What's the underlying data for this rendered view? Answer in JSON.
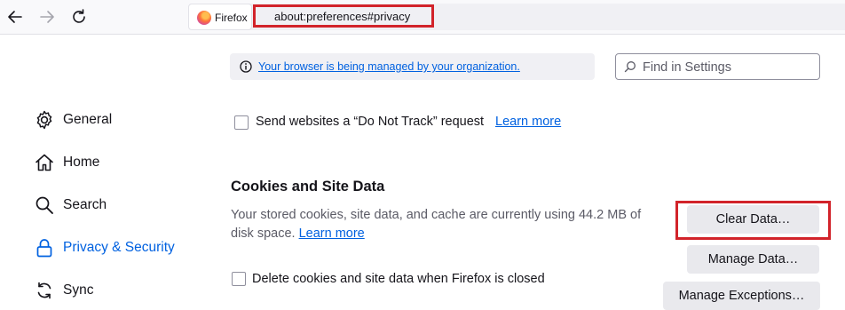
{
  "toolbar": {
    "identity_label": "Firefox",
    "url": "about:preferences#privacy"
  },
  "notice": {
    "text": "Your browser is being managed by your organization."
  },
  "search": {
    "placeholder": "Find in Settings"
  },
  "sidebar": {
    "items": [
      {
        "label": "General",
        "icon": "gear-icon"
      },
      {
        "label": "Home",
        "icon": "home-icon"
      },
      {
        "label": "Search",
        "icon": "search-icon"
      },
      {
        "label": "Privacy & Security",
        "icon": "lock-icon",
        "selected": true
      },
      {
        "label": "Sync",
        "icon": "sync-icon"
      }
    ]
  },
  "dnt": {
    "label": "Send websites a “Do Not Track” request",
    "learn_more": "Learn more"
  },
  "cookies": {
    "title": "Cookies and Site Data",
    "description": "Your stored cookies, site data, and cache are currently using 44.2 MB of disk space.",
    "learn_more": "Learn more",
    "clear_data": "Clear Data…",
    "manage_data": "Manage Data…",
    "manage_exceptions": "Manage Exceptions…",
    "delete_on_close": "Delete cookies and site data when Firefox is closed"
  },
  "colors": {
    "accent": "#0061e0",
    "annotation": "#d2232a"
  }
}
